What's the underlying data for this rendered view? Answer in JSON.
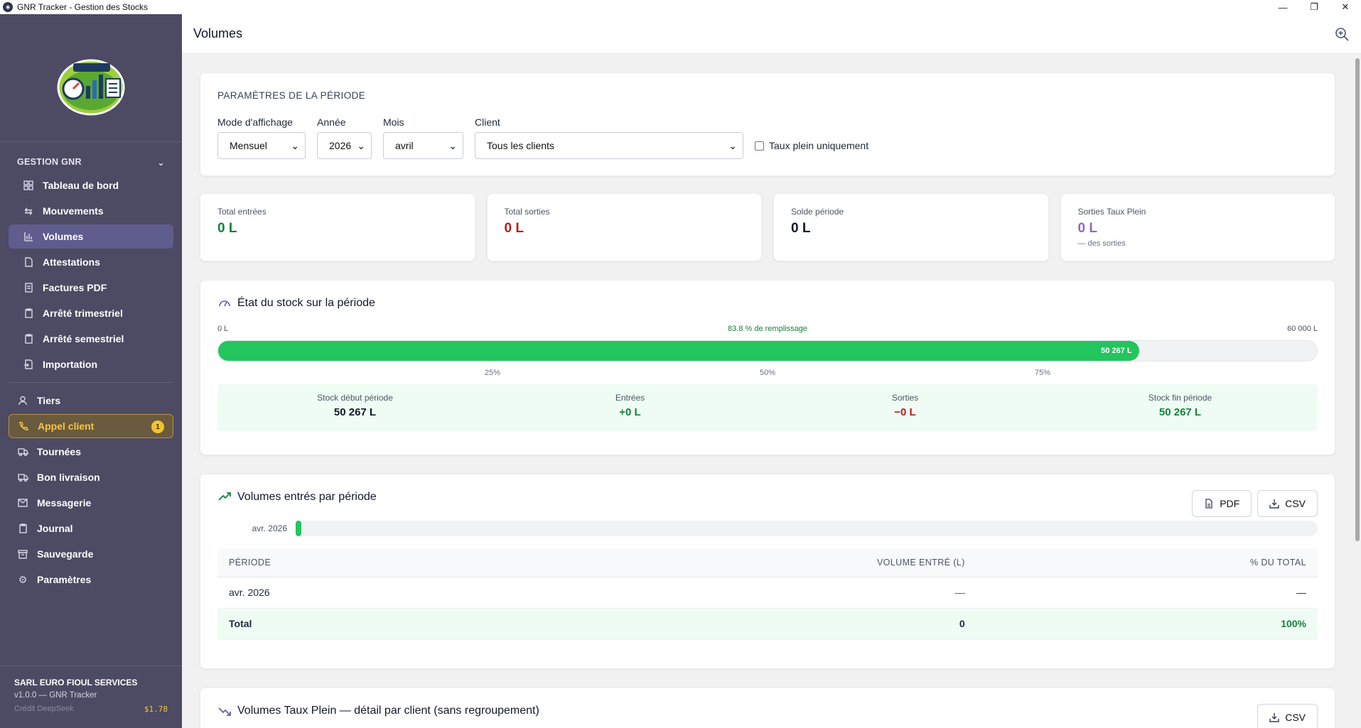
{
  "window": {
    "title": "GNR Tracker - Gestion des Stocks",
    "minimize": "—",
    "maximize": "❐",
    "close": "✕"
  },
  "sidebar": {
    "section": "GESTION GNR",
    "group_items": [
      {
        "label": "Tableau de bord",
        "icon": "dashboard-icon"
      },
      {
        "label": "Mouvements",
        "icon": "swap-icon"
      },
      {
        "label": "Volumes",
        "icon": "bar-chart-icon"
      },
      {
        "label": "Attestations",
        "icon": "document-icon"
      },
      {
        "label": "Factures PDF",
        "icon": "invoice-icon"
      },
      {
        "label": "Arrêté trimestriel",
        "icon": "clipboard-icon"
      },
      {
        "label": "Arrêté semestriel",
        "icon": "clipboard-icon"
      },
      {
        "label": "Importation",
        "icon": "import-icon"
      }
    ],
    "top_items": [
      {
        "label": "Tiers",
        "icon": "users-icon"
      },
      {
        "label": "Appel client",
        "icon": "phone-icon",
        "badge": "1"
      },
      {
        "label": "Tournées",
        "icon": "truck-icon"
      },
      {
        "label": "Bon livraison",
        "icon": "truck-icon"
      },
      {
        "label": "Messagerie",
        "icon": "mail-icon"
      },
      {
        "label": "Journal",
        "icon": "clipboard-icon"
      },
      {
        "label": "Sauvegarde",
        "icon": "archive-icon"
      },
      {
        "label": "Paramètres",
        "icon": "gear-icon"
      }
    ],
    "footer": {
      "company": "SARL EURO FIOUL SERVICES",
      "version": "v1.0.0 — GNR Tracker",
      "credit_label": "Crédit DeepSeek",
      "credit_value": "$1.78"
    }
  },
  "header": {
    "title": "Volumes"
  },
  "params": {
    "heading": "PARAMÈTRES DE LA PÉRIODE",
    "mode": {
      "label": "Mode d'affichage",
      "value": "Mensuel"
    },
    "year": {
      "label": "Année",
      "value": "2026"
    },
    "month": {
      "label": "Mois",
      "value": "avril"
    },
    "client": {
      "label": "Client",
      "value": "Tous les clients"
    },
    "checkbox": "Taux plein uniquement"
  },
  "stats": [
    {
      "label": "Total entrées",
      "value": "0 L",
      "color": "#15803d"
    },
    {
      "label": "Total sorties",
      "value": "0 L",
      "color": "#b91c1c"
    },
    {
      "label": "Solde période",
      "value": "0 L",
      "color": "#111827"
    },
    {
      "label": "Sorties Taux Plein",
      "value": "0 L",
      "color": "#8b6bb8",
      "sub": "— des sorties"
    }
  ],
  "stock": {
    "title": "État du stock sur la période",
    "min_label": "0 L",
    "max_label": "60 000 L",
    "fill_label": "83.8 % de remplissage",
    "fill_fraction": 0.838,
    "fill_value": "50 267 L",
    "ticks": [
      "25%",
      "50%",
      "75%"
    ],
    "summary": [
      {
        "label": "Stock début période",
        "value": "50 267 L",
        "color": "#111827"
      },
      {
        "label": "Entrées",
        "value": "+0 L",
        "color": "#15803d"
      },
      {
        "label": "Sorties",
        "value": "−0 L",
        "color": "#b91c1c"
      },
      {
        "label": "Stock fin période",
        "value": "50 267 L",
        "color": "#15803d"
      }
    ]
  },
  "volumes": {
    "title": "Volumes entrés par période",
    "pdf_label": "PDF",
    "csv_label": "CSV",
    "bar_label": "avr. 2026",
    "columns": [
      "PÉRIODE",
      "VOLUME ENTRÉ (L)",
      "% DU TOTAL"
    ],
    "rows": [
      {
        "period": "avr. 2026",
        "volume": "—",
        "percent": "—"
      }
    ],
    "total": {
      "label": "Total",
      "volume": "0",
      "percent": "100%"
    }
  },
  "taux_plein": {
    "title": "Volumes Taux Plein — détail par client (sans regroupement)",
    "csv_label": "CSV"
  },
  "colors": {
    "sidebar": "#4d4a63",
    "accent_green": "#22c55e",
    "active_item": "#5f5c8e",
    "badge": "#f2c230"
  }
}
